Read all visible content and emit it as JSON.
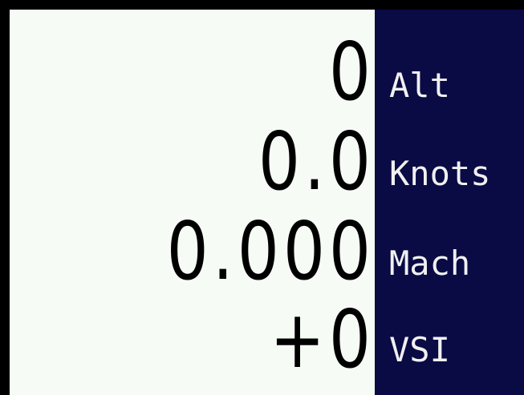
{
  "readouts": [
    {
      "label": "Alt",
      "value": "0"
    },
    {
      "label": "Knots",
      "value": "0.0"
    },
    {
      "label": "Mach",
      "value": "0.000"
    },
    {
      "label": "VSI",
      "value": "+0"
    }
  ],
  "colors": {
    "frame": "#000000",
    "values_background": "#f6fbf6",
    "labels_background": "#0a0a45",
    "value_text": "#000000",
    "label_text": "#f0f0f0"
  }
}
